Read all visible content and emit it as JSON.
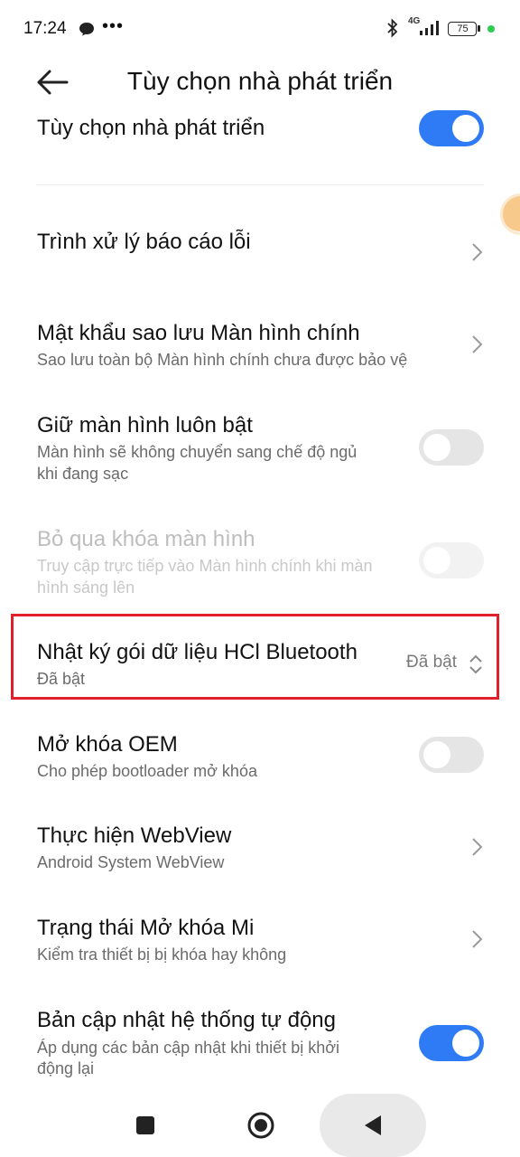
{
  "status_bar": {
    "time": "17:24",
    "dots": "•••",
    "network": "4G",
    "battery": "75"
  },
  "header": {
    "title": "Tùy chọn nhà phát triển"
  },
  "settings": [
    {
      "title": "Tùy chọn nhà phát triển",
      "subtitle": "",
      "control": "toggle",
      "state": "on"
    },
    {
      "title": "Trình xử lý báo cáo lỗi",
      "subtitle": "",
      "control": "chevron"
    },
    {
      "title": "Mật khẩu sao lưu Màn hình chính",
      "subtitle": "Sao lưu toàn bộ Màn hình chính chưa được bảo vệ",
      "control": "chevron"
    },
    {
      "title": "Giữ màn hình luôn bật",
      "subtitle_line1": "Màn hình sẽ không chuyển sang chế độ ngủ",
      "subtitle_line2": "khi đang sạc",
      "control": "toggle",
      "state": "off"
    },
    {
      "title": "Bỏ qua khóa màn hình",
      "subtitle_line1": "Truy cập trực tiếp vào Màn hình chính khi màn",
      "subtitle_line2": "hình sáng lên",
      "control": "toggle",
      "state": "disabled"
    },
    {
      "title": "Nhật ký gói dữ liệu HCl Bluetooth",
      "subtitle": "Đã bật",
      "value": "Đã bật",
      "control": "dropdown",
      "highlight_color": "#e0202a"
    },
    {
      "title": "Mở khóa OEM",
      "subtitle": "Cho phép bootloader mở khóa",
      "control": "toggle",
      "state": "off"
    },
    {
      "title": "Thực hiện WebView",
      "subtitle": "Android System WebView",
      "control": "chevron"
    },
    {
      "title": "Trạng thái Mở khóa Mi",
      "subtitle": "Kiểm tra thiết bị bị khóa hay không",
      "control": "chevron"
    },
    {
      "title": "Bản cập nhật hệ thống tự động",
      "subtitle_line1": "Áp dụng các bản cập nhật khi thiết bị khởi",
      "subtitle_line2": "động lại",
      "control": "toggle",
      "state": "on"
    }
  ],
  "colors": {
    "accent": "#2f7bf5",
    "highlight": "#e0202a"
  },
  "nav": {
    "icons": [
      "recents-square-icon",
      "home-circle-icon",
      "back-triangle-icon"
    ]
  }
}
